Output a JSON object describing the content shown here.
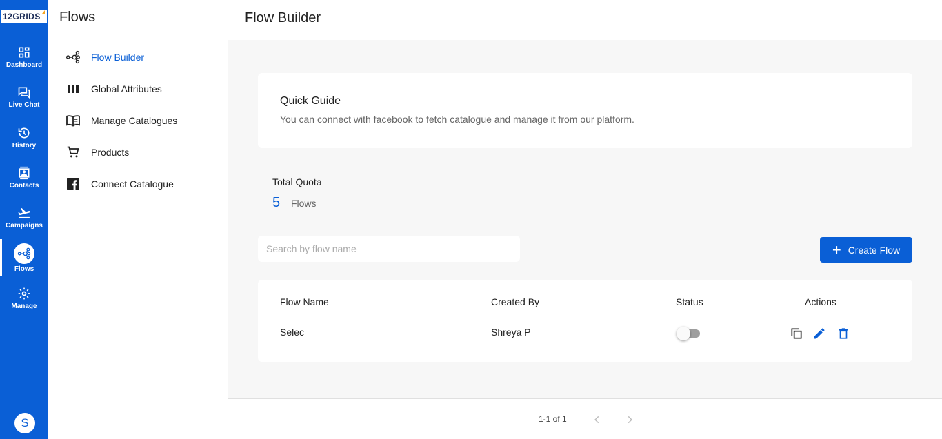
{
  "rail": {
    "logo": "12GRIDS",
    "items": [
      {
        "label": "Dashboard",
        "icon": "dashboard-icon"
      },
      {
        "label": "Live Chat",
        "icon": "chat-icon"
      },
      {
        "label": "History",
        "icon": "history-icon"
      },
      {
        "label": "Contacts",
        "icon": "contacts-icon"
      },
      {
        "label": "Campaigns",
        "icon": "flight-takeoff-icon"
      },
      {
        "label": "Flows",
        "icon": "flow-icon"
      },
      {
        "label": "Manage",
        "icon": "gear-icon"
      }
    ],
    "avatar_initial": "S",
    "accent": "#0a5fd6"
  },
  "sidebar": {
    "title": "Flows",
    "items": [
      {
        "label": "Flow Builder",
        "icon": "flow-icon",
        "active": true
      },
      {
        "label": "Global Attributes",
        "icon": "columns-icon"
      },
      {
        "label": "Manage Catalogues",
        "icon": "book-icon"
      },
      {
        "label": "Products",
        "icon": "cart-icon"
      },
      {
        "label": "Connect Catalogue",
        "icon": "facebook-icon"
      }
    ]
  },
  "header": {
    "title": "Flow Builder"
  },
  "guide": {
    "title": "Quick Guide",
    "text": "You can connect with facebook to fetch catalogue and manage it from our platform."
  },
  "quota": {
    "label": "Total Quota",
    "value": "5",
    "unit": "Flows"
  },
  "search": {
    "placeholder": "Search by flow name",
    "value": ""
  },
  "create_button": {
    "label": "Create Flow"
  },
  "table": {
    "columns": [
      "Flow Name",
      "Created By",
      "Status",
      "Actions"
    ],
    "rows": [
      {
        "flow_name": "Selec",
        "created_by": "Shreya P",
        "status_on": false
      }
    ],
    "actions": [
      "copy-icon",
      "edit-icon",
      "delete-icon"
    ]
  },
  "pagination": {
    "text": "1-1 of 1"
  }
}
